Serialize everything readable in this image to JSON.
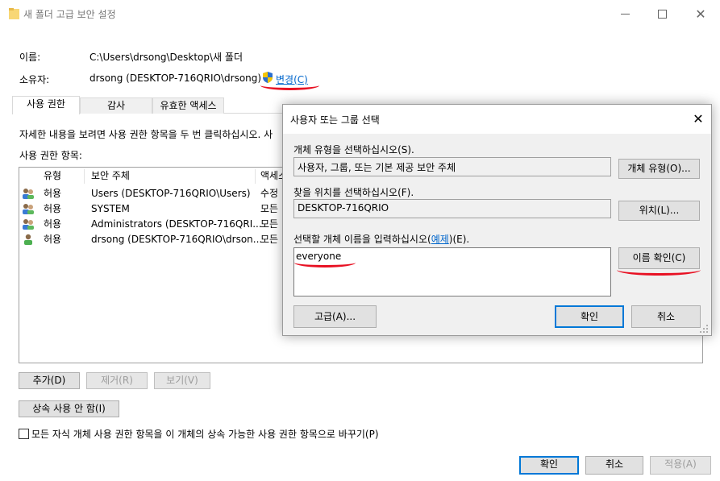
{
  "window": {
    "title": "새 폴더 고급 보안 설정"
  },
  "info": {
    "name_label": "이름:",
    "name_value": "C:\\Users\\drsong\\Desktop\\새 폴더",
    "owner_label": "소유자:",
    "owner_value": "drsong (DESKTOP-716QRIO\\drsong)",
    "change_link": "변경(C)"
  },
  "tabs": [
    {
      "label": "사용 권한"
    },
    {
      "label": "감사"
    },
    {
      "label": "유효한 액세스"
    }
  ],
  "instructions": "자세한 내용을 보려면 사용 권한 항목을 두 번 클릭하십시오. 사",
  "entries_label": "사용 권한 항목:",
  "table": {
    "headers": [
      "유형",
      "보안 주체",
      "액세스"
    ],
    "rows": [
      {
        "type": "허용",
        "principal": "Users (DESKTOP-716QRIO\\Users)",
        "access": "수정",
        "icon": "group-users-icon"
      },
      {
        "type": "허용",
        "principal": "SYSTEM",
        "access": "모든",
        "icon": "group-users-icon"
      },
      {
        "type": "허용",
        "principal": "Administrators (DESKTOP-716QRI...",
        "access": "모든",
        "icon": "group-users-icon"
      },
      {
        "type": "허용",
        "principal": "drsong (DESKTOP-716QRIO\\drson...",
        "access": "모든",
        "icon": "single-user-icon"
      }
    ]
  },
  "buttons": {
    "add": "추가(D)",
    "remove": "제거(R)",
    "view": "보기(V)",
    "disable_inheritance": "상속 사용 안 함(I)",
    "ok": "확인",
    "cancel": "취소",
    "apply": "적용(A)"
  },
  "replace_checkbox_label": "모든 자식 개체 사용 권한 항목을 이 개체의 상속 가능한 사용 권한 항목으로 바꾸기(P)",
  "dialog": {
    "title": "사용자 또는 그룹 선택",
    "object_type_label": "개체 유형을 선택하십시오(S).",
    "object_type_value": "사용자, 그룹, 또는 기본 제공 보안 주체",
    "object_types_button": "개체 유형(O)...",
    "location_label": "찾을 위치를 선택하십시오(F).",
    "location_value": "DESKTOP-716QRIO",
    "locations_button": "위치(L)...",
    "enter_names_label_prefix": "선택할 개체 이름을 입력하십시오(",
    "enter_names_label_link": "예제",
    "enter_names_label_suffix": ")(E).",
    "names_value": "everyone",
    "check_names_button": "이름 확인(C)",
    "advanced_button": "고급(A)...",
    "ok_button": "확인",
    "cancel_button": "취소"
  },
  "colors": {
    "accent": "#0078d7",
    "link": "#0066cc",
    "annotation_red": "#e81123"
  }
}
